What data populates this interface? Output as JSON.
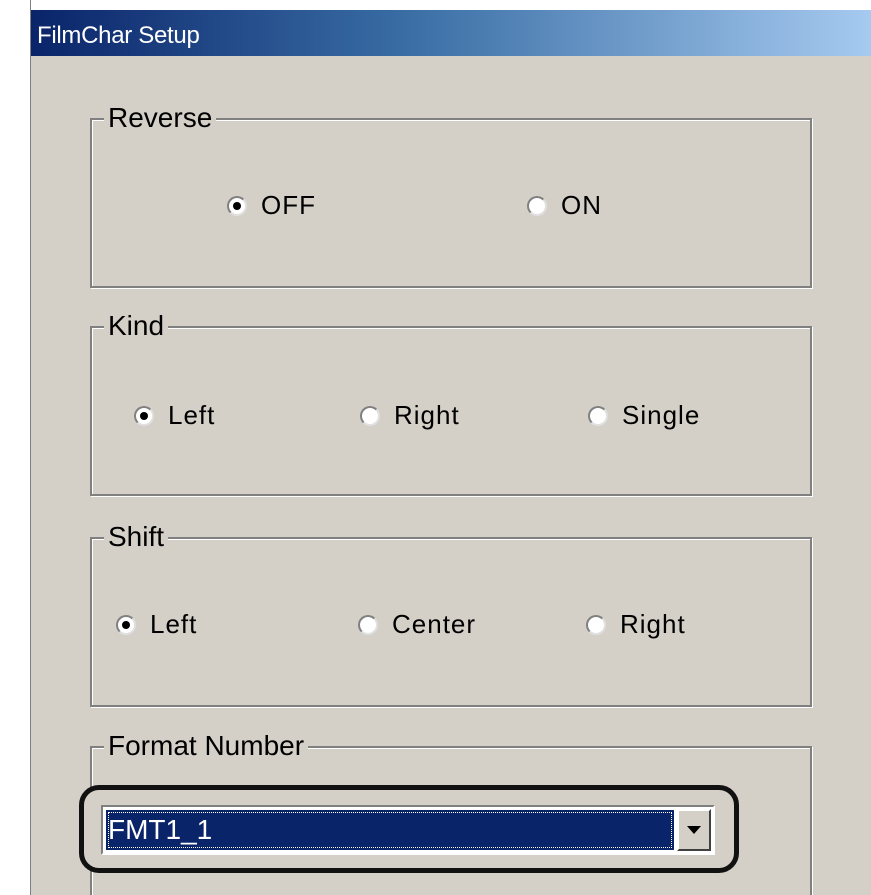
{
  "window": {
    "title": "FilmChar Setup"
  },
  "groups": {
    "reverse": {
      "legend": "Reverse",
      "options": [
        "OFF",
        "ON"
      ],
      "selected": "OFF"
    },
    "kind": {
      "legend": "Kind",
      "options": [
        "Left",
        "Right",
        "Single"
      ],
      "selected": "Left"
    },
    "shift": {
      "legend": "Shift",
      "options": [
        "Left",
        "Center",
        "Right"
      ],
      "selected": "Left"
    },
    "format_number": {
      "legend": "Format Number",
      "selected_value": "FMT1_1"
    }
  },
  "icons": {
    "dropdown": "chevron-down-icon"
  },
  "colors": {
    "dialog_bg": "#d4d0c8",
    "selection_bg": "#0a246a",
    "title_gradient_start": "#0a246a",
    "title_gradient_end": "#a6caf0"
  }
}
